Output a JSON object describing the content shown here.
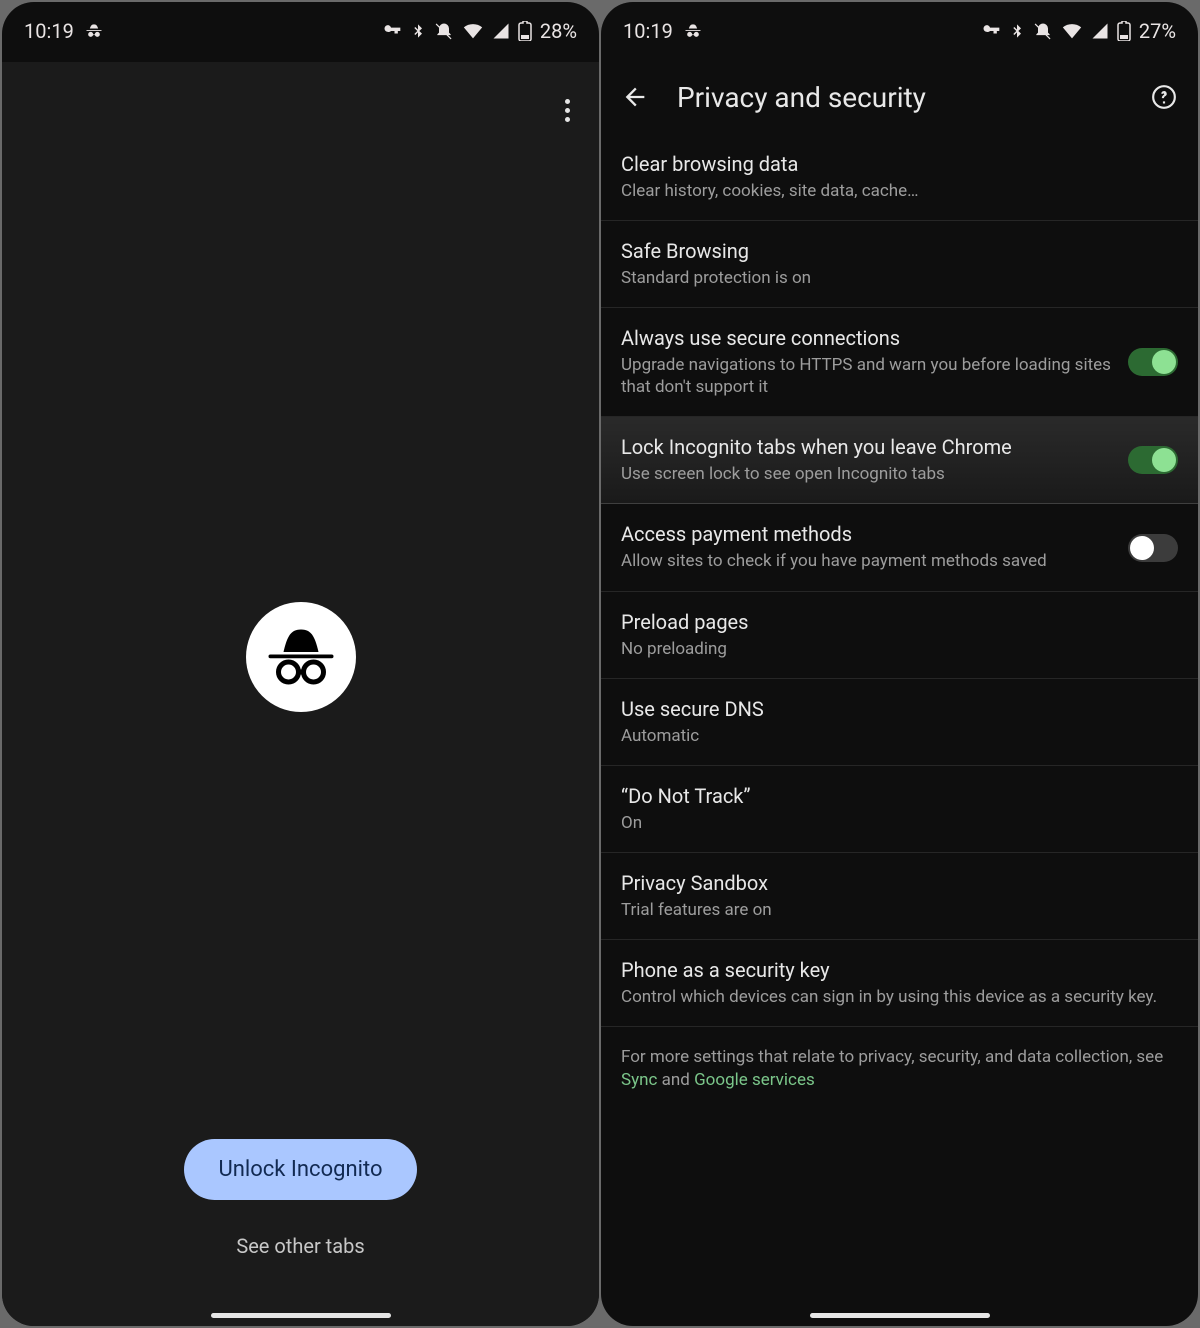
{
  "left": {
    "status": {
      "time": "10:19",
      "battery": "28%"
    },
    "unlock_button_label": "Unlock Incognito",
    "see_other_tabs_label": "See other tabs"
  },
  "right": {
    "status": {
      "time": "10:19",
      "battery": "27%"
    },
    "page_title": "Privacy and security",
    "items": [
      {
        "title": "Clear browsing data",
        "subtitle": "Clear history, cookies, site data, cache…",
        "toggle": null
      },
      {
        "title": "Safe Browsing",
        "subtitle": "Standard protection is on",
        "toggle": null
      },
      {
        "title": "Always use secure connections",
        "subtitle": "Upgrade navigations to HTTPS and warn you before loading sites that don't support it",
        "toggle": true
      },
      {
        "title": "Lock Incognito tabs when you leave Chrome",
        "subtitle": "Use screen lock to see open Incognito tabs",
        "toggle": true,
        "active": true
      },
      {
        "title": "Access payment methods",
        "subtitle": "Allow sites to check if you have payment methods saved",
        "toggle": false
      },
      {
        "title": "Preload pages",
        "subtitle": "No preloading",
        "toggle": null
      },
      {
        "title": "Use secure DNS",
        "subtitle": "Automatic",
        "toggle": null
      },
      {
        "title": "“Do Not Track”",
        "subtitle": "On",
        "toggle": null
      },
      {
        "title": "Privacy Sandbox",
        "subtitle": "Trial features are on",
        "toggle": null
      },
      {
        "title": "Phone as a security key",
        "subtitle": "Control which devices can sign in by using this device as a security key.",
        "toggle": null
      }
    ],
    "footer_prefix": "For more settings that relate to privacy, security, and data collection, see ",
    "footer_link1": "Sync",
    "footer_sep": " and ",
    "footer_link2": "Google services"
  }
}
